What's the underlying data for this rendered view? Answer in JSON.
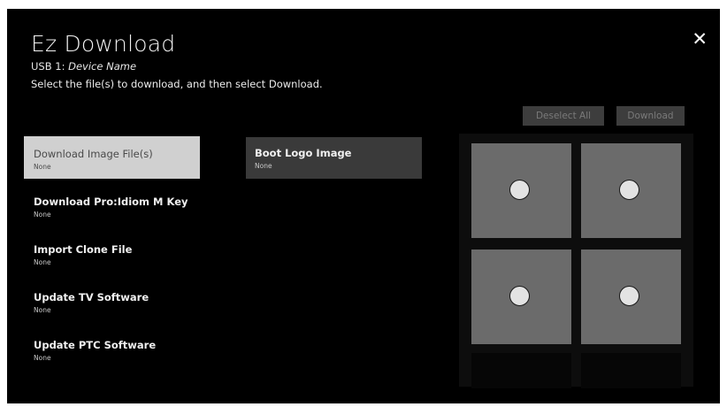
{
  "header": {
    "title": "Ez Download",
    "usb_label": "USB 1:",
    "usb_device": "Device Name",
    "instruction": "Select the file(s) to download, and then select Download.",
    "close_glyph": "✕"
  },
  "actions": {
    "deselect_label": "Deselect All",
    "download_label": "Download"
  },
  "menu": {
    "items": [
      {
        "label": "Download Image File(s)",
        "sub": "None",
        "selected": true
      },
      {
        "label": "Download Pro:Idiom M Key",
        "sub": "None"
      },
      {
        "label": "Import Clone File",
        "sub": "None"
      },
      {
        "label": "Update TV Software",
        "sub": "None"
      },
      {
        "label": "Update PTC Software",
        "sub": "None"
      }
    ]
  },
  "submenu": {
    "label": "Boot Logo Image",
    "sub": "None"
  },
  "thumbnails": {
    "count": 4,
    "selected": [
      false,
      false,
      false,
      false
    ]
  },
  "colors": {
    "panel_bg": "#000000",
    "selected_item_bg": "#d0d0d0",
    "submenu_bg": "#3a3a3a",
    "tile_bg": "#6b6b6b",
    "button_bg": "#3d3d3d"
  }
}
